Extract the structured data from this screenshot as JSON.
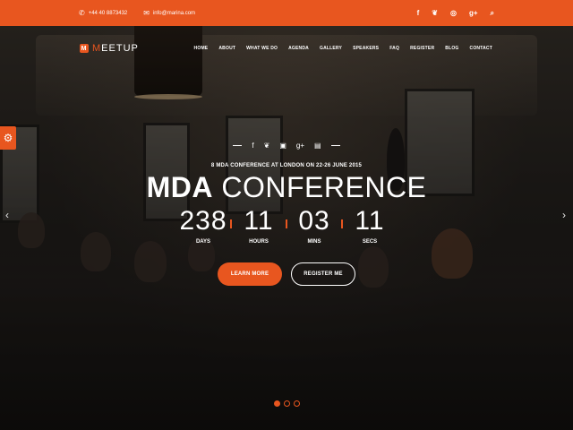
{
  "topbar": {
    "phone_icon": "phone-icon",
    "phone": "+44 40 8873432",
    "email_icon": "envelope-icon",
    "email": "info@marina.com",
    "social": [
      {
        "icon": "facebook-icon",
        "glyph": "f"
      },
      {
        "icon": "twitter-icon",
        "glyph": "❦"
      },
      {
        "icon": "dribbble-icon",
        "glyph": "◎"
      },
      {
        "icon": "googleplus-icon",
        "glyph": "g+"
      },
      {
        "icon": "search-icon",
        "glyph": "⌕"
      }
    ]
  },
  "logo": {
    "mark": "M",
    "first": "M",
    "rest": "EETUP"
  },
  "nav": [
    "HOME",
    "ABOUT",
    "WHAT WE DO",
    "AGENDA",
    "GALLERY",
    "SPEAKERS",
    "FAQ",
    "REGISTER",
    "BLOG",
    "CONTACT"
  ],
  "hero": {
    "social": [
      {
        "icon": "facebook-icon",
        "glyph": "f"
      },
      {
        "icon": "twitter-icon",
        "glyph": "❦"
      },
      {
        "icon": "instagram-icon",
        "glyph": "▣"
      },
      {
        "icon": "googleplus-icon",
        "glyph": "g+"
      },
      {
        "icon": "linkedin-icon",
        "glyph": "▤"
      }
    ],
    "subtitle": "8 MDA CONFERENCE AT LONDON ON 22-26 JUNE 2015",
    "title_strong": "MDA",
    "title_thin": " CONFERENCE",
    "countdown": [
      {
        "num": "238",
        "label": "DAYS"
      },
      {
        "num": "11",
        "label": "HOURS"
      },
      {
        "num": "03",
        "label": "MINS"
      },
      {
        "num": "11",
        "label": "SECS"
      }
    ],
    "learn_more": "LEARN MORE",
    "register": "REGISTER ME",
    "prev_glyph": "‹",
    "next_glyph": "›",
    "slider_dots": 3,
    "active_dot": 0
  },
  "settings": {
    "icon": "gear-icon",
    "glyph": "⚙"
  },
  "colors": {
    "accent": "#e8561f"
  }
}
